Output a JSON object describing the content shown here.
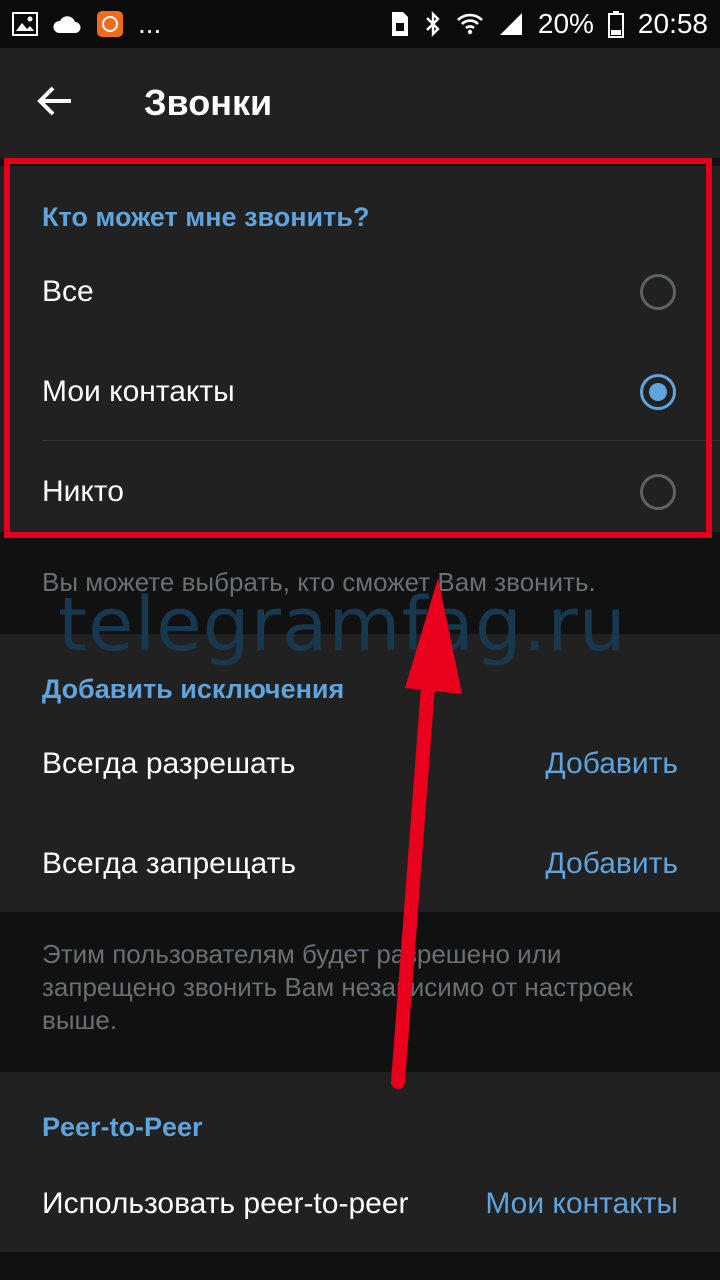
{
  "status_bar": {
    "battery": "20%",
    "time": "20:58",
    "more": "...",
    "icons": [
      "image-icon",
      "cloud-icon",
      "app-icon",
      "sim-icon",
      "bluetooth-icon",
      "wifi-icon",
      "signal-icon",
      "battery-icon"
    ]
  },
  "app_bar": {
    "title": "Звонки",
    "back_icon": "arrow-left-icon"
  },
  "who_can_call": {
    "header": "Кто может мне звонить?",
    "options": [
      {
        "label": "Все",
        "selected": false
      },
      {
        "label": "Мои контакты",
        "selected": true
      },
      {
        "label": "Никто",
        "selected": false
      }
    ],
    "hint": "Вы можете выбрать, кто сможет Вам звонить."
  },
  "watermark": "telegramfag.ru",
  "exceptions": {
    "header": "Добавить исключения",
    "rows": [
      {
        "label": "Всегда разрешать",
        "action": "Добавить"
      },
      {
        "label": "Всегда запрещать",
        "action": "Добавить"
      }
    ],
    "hint": "Этим пользователям будет разрешено или запрещено звонить Вам независимо от настроек выше."
  },
  "p2p": {
    "header": "Peer-to-Peer",
    "row": {
      "label": "Использовать peer-to-peer",
      "value": "Мои контакты"
    }
  },
  "colors": {
    "accent": "#5fa4dd",
    "highlight_border": "#e0001b",
    "arrow": "#e8001c",
    "background": "#111111",
    "section": "#212121"
  }
}
